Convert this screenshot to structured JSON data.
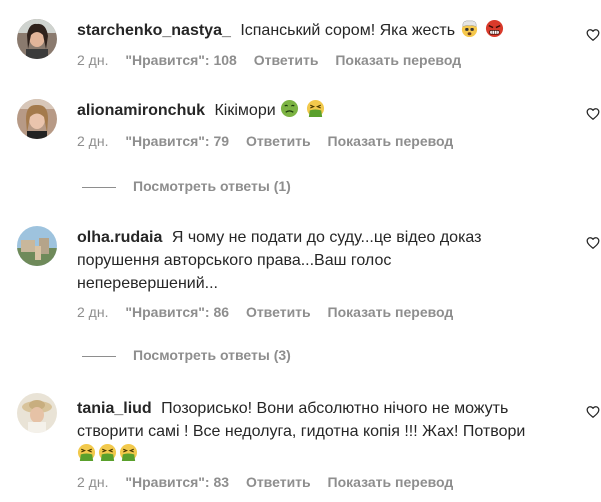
{
  "colors": {
    "text": "#262626",
    "meta": "#8e8e8e",
    "background": "#ffffff"
  },
  "comments": [
    {
      "username": "starchenko_nastya_",
      "text": "Іспанський сором! Яка жесть",
      "emojis": [
        "exploding-head",
        "angry-face"
      ],
      "time": "2 дн.",
      "likes": "\"Нравится\": 108",
      "reply": "Ответить",
      "translate": "Показать перевод"
    },
    {
      "username": "alionamironchuk",
      "text": "Кікімори",
      "emojis": [
        "nauseated-face",
        "vomiting-face"
      ],
      "time": "2 дн.",
      "likes": "\"Нравится\": 79",
      "reply": "Ответить",
      "translate": "Показать перевод",
      "view_replies": "Посмотреть ответы (1)"
    },
    {
      "username": "olha.rudaia",
      "text_lines": [
        "Я чому не подати до суду...це відео доказ",
        "порушення авторського права...Ваш голос",
        "неперевершений..."
      ],
      "time": "2 дн.",
      "likes": "\"Нравится\": 86",
      "reply": "Ответить",
      "translate": "Показать перевод",
      "view_replies": "Посмотреть ответы (3)"
    },
    {
      "username": "tania_liud",
      "text_lines": [
        "Позорисько! Вони абсолютно нічого не можуть",
        "створити самі ! Все недолуга, гидотна копія !!! Жах! Потвори"
      ],
      "emojis": [
        "vomiting-face",
        "vomiting-face",
        "vomiting-face"
      ],
      "time": "2 дн.",
      "likes": "\"Нравится\": 83",
      "reply": "Ответить",
      "translate": "Показать перевод"
    }
  ]
}
